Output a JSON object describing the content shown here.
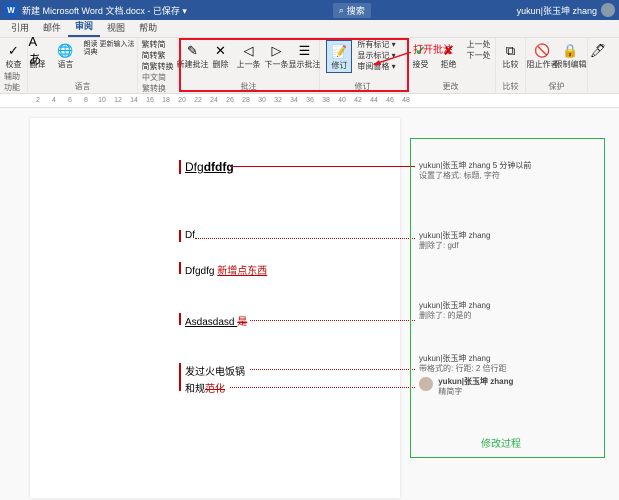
{
  "titlebar": {
    "app_icon": "W",
    "title": "新建 Microsoft Word 文档.docx - 已保存 ▾",
    "search_icon": "⌕",
    "search_text": "搜索",
    "user_name": "yukun|张玉坤 zhang"
  },
  "tabs": [
    "引用",
    "邮件",
    "审阅",
    "视图",
    "帮助"
  ],
  "active_tab": "审阅",
  "ribbon": {
    "group_lang": {
      "items": [
        {
          "icon": "✓",
          "label": "校查"
        },
        {
          "icon": "Aあ",
          "label": "翻译"
        },
        {
          "icon": "🌐",
          "label": "语言"
        }
      ],
      "aux": "朗读 更新输入法词典",
      "label": "语言"
    },
    "group_cn": {
      "items": [
        "繁转简",
        "简转繁",
        "简繁转换"
      ],
      "label": "中文简繁转换"
    },
    "group_comment": {
      "items": [
        {
          "icon": "✎",
          "label": "新建批注"
        },
        {
          "icon": "✕",
          "label": "删除"
        },
        {
          "icon": "◁",
          "label": "上一条"
        },
        {
          "icon": "▷",
          "label": "下一条"
        },
        {
          "icon": "☰",
          "label": "显示批注"
        }
      ],
      "label": "批注"
    },
    "group_track": {
      "main": {
        "icon": "📝",
        "label": "修订"
      },
      "opts": [
        "所有标记 ▾",
        "显示标记 ▾",
        "审阅窗格 ▾"
      ],
      "label": "修订"
    },
    "group_changes": {
      "items": [
        {
          "icon": "✔",
          "label": "接受"
        },
        {
          "icon": "✘",
          "label": "拒绝"
        }
      ],
      "nav": [
        "上一处",
        "下一处"
      ],
      "label": "更改"
    },
    "group_compare": {
      "icon": "⧉",
      "label": "比较",
      "glabel": "比较"
    },
    "group_protect": {
      "items": [
        {
          "icon": "🚫",
          "label": "阻止作者"
        },
        {
          "icon": "🔒",
          "label": "限制编辑"
        }
      ],
      "label": "保护"
    },
    "group_ink": {
      "icon": "🖊",
      "label": ""
    }
  },
  "red_annotation": "打开批注",
  "ruler_marks": [
    "2",
    "4",
    "6",
    "8",
    "10",
    "12",
    "14",
    "16",
    "18",
    "20",
    "22",
    "24",
    "26",
    "28",
    "30",
    "32",
    "34",
    "36",
    "38",
    "40",
    "42",
    "44",
    "46",
    "48"
  ],
  "document": {
    "l1a": "Dfg",
    "l1b": "dfdfg",
    "l2": "Df",
    "l3a": "Dfgdfg ",
    "l3b": "新增点东西",
    "l4a": "Asdasdasd ",
    "l4b": "是",
    "l5": "发过火电饭锅",
    "l6a": "和规",
    "l6b": "范化"
  },
  "comments": [
    {
      "author": "yukun|张玉坤 zhang",
      "time": "5 分钟以前",
      "body": "设置了格式: 标题, 字符"
    },
    {
      "author": "yukun|张玉坤 zhang",
      "body": "删除了: gdf"
    },
    {
      "author": "yukun|张玉坤 zhang",
      "body": "删除了: 的是的"
    },
    {
      "author": "yukun|张玉坤 zhang",
      "body": "带格式的: 行距: 2 倍行距"
    },
    {
      "author": "yukun|张玉坤 zhang",
      "body": "精简字"
    }
  ],
  "green_annotation": "修改过程"
}
